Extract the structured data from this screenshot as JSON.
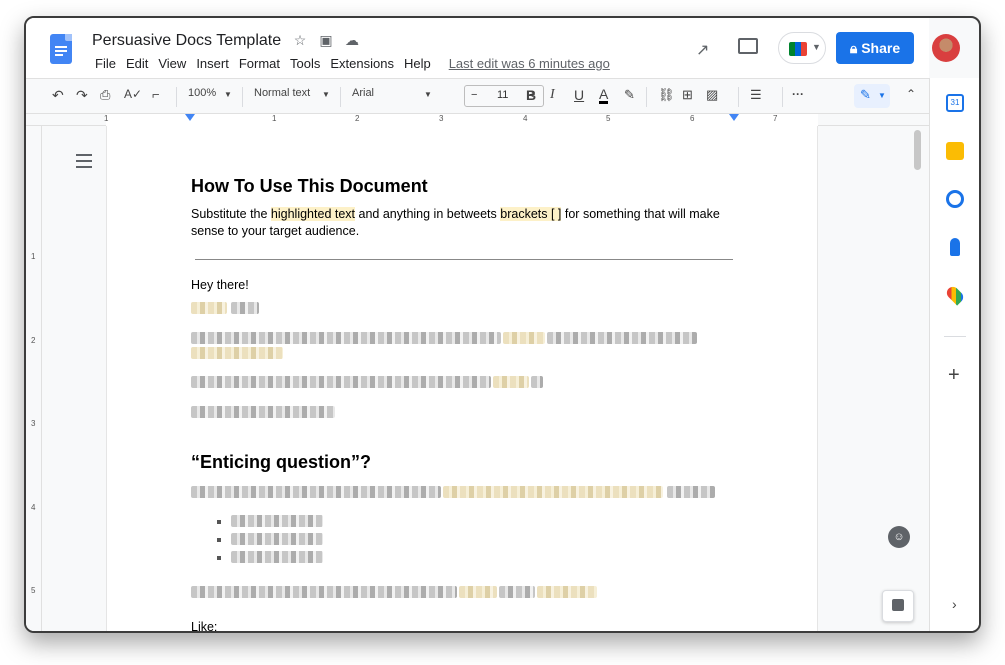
{
  "app": {
    "title": "Persuasive Docs Template",
    "menu": [
      "File",
      "Edit",
      "View",
      "Insert",
      "Format",
      "Tools",
      "Extensions",
      "Help"
    ],
    "last_edit": "Last edit was 6 minutes ago",
    "share_label": "Share",
    "share_icon": "lock-icon",
    "brand_color": "#1a73e8"
  },
  "toolbar": {
    "zoom": "100%",
    "style": "Normal text",
    "font": "Arial",
    "font_size": "11",
    "minus": "−",
    "plus": "+",
    "bold": "B",
    "italic": "I",
    "underline": "U",
    "text_color": "A",
    "more": "···"
  },
  "ruler": {
    "numbers": [
      "1",
      "1",
      "2",
      "3",
      "4",
      "5",
      "6",
      "7"
    ]
  },
  "vertical_ruler": [
    "1",
    "2",
    "3",
    "4",
    "5"
  ],
  "document": {
    "heading": "How To Use This Document",
    "intro_before": "Substitute the ",
    "intro_hl1": "highlighted text",
    "intro_mid": " and anything in betweets ",
    "intro_hl2": "brackets [ ]",
    "intro_after": " for something that will make sense to your target audience.",
    "greeting": "Hey there!",
    "heading2": "“Enticing question”?",
    "like": "Like:"
  },
  "sidepanel": {
    "calendar_label": "31",
    "icons": [
      "calendar-icon",
      "keep-icon",
      "tasks-icon",
      "contacts-icon",
      "maps-icon"
    ],
    "plus": "+",
    "chevron": "›"
  }
}
